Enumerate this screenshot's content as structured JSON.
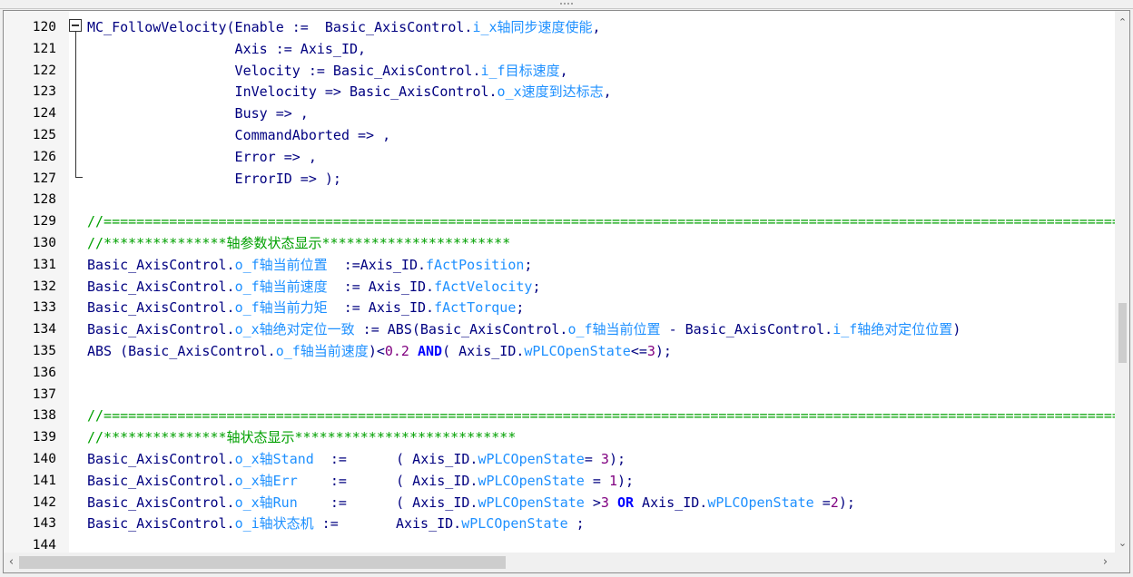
{
  "editor": {
    "lines": [
      {
        "n": "120",
        "code": "MC_FollowVelocity(Enable :=  Basic_AxisControl.i_x轴同步速度使能,"
      },
      {
        "n": "121",
        "code": "                  Axis := Axis_ID,"
      },
      {
        "n": "122",
        "code": "                  Velocity := Basic_AxisControl.i_f目标速度,"
      },
      {
        "n": "123",
        "code": "                  InVelocity => Basic_AxisControl.o_x速度到达标志,"
      },
      {
        "n": "124",
        "code": "                  Busy => ,"
      },
      {
        "n": "125",
        "code": "                  CommandAborted => ,"
      },
      {
        "n": "126",
        "code": "                  Error => ,"
      },
      {
        "n": "127",
        "code": "                  ErrorID => );"
      },
      {
        "n": "128",
        "code": ""
      },
      {
        "n": "129",
        "code": "//=================================================================================================================================="
      },
      {
        "n": "130",
        "code": "//***************轴参数状态显示***********************"
      },
      {
        "n": "131",
        "code": "Basic_AxisControl.o_f轴当前位置  :=Axis_ID.fActPosition;"
      },
      {
        "n": "132",
        "code": "Basic_AxisControl.o_f轴当前速度  := Axis_ID.fActVelocity;"
      },
      {
        "n": "133",
        "code": "Basic_AxisControl.o_f轴当前力矩  := Axis_ID.fActTorque;"
      },
      {
        "n": "134",
        "code": "Basic_AxisControl.o_x轴绝对定位一致 := ABS(Basic_AxisControl.o_f轴当前位置 - Basic_AxisControl.i_f轴绝对定位位置)"
      },
      {
        "n": "135",
        "code": "ABS (Basic_AxisControl.o_f轴当前速度)<0.2 AND( Axis_ID.wPLCOpenState<=3);"
      },
      {
        "n": "136",
        "code": ""
      },
      {
        "n": "137",
        "code": ""
      },
      {
        "n": "138",
        "code": "//=================================================================================================================================="
      },
      {
        "n": "139",
        "code": "//***************轴状态显示***************************"
      },
      {
        "n": "140",
        "code": "Basic_AxisControl.o_x轴Stand  :=      ( Axis_ID.wPLCOpenState= 3);"
      },
      {
        "n": "141",
        "code": "Basic_AxisControl.o_x轴Err    :=      ( Axis_ID.wPLCOpenState = 1);"
      },
      {
        "n": "142",
        "code": "Basic_AxisControl.o_x轴Run    :=      ( Axis_ID.wPLCOpenState >3 OR Axis_ID.wPLCOpenState =2);"
      },
      {
        "n": "143",
        "code": "Basic_AxisControl.o_i轴状态机 :=       Axis_ID.wPLCOpenState ;"
      },
      {
        "n": "144",
        "code": ""
      }
    ]
  },
  "colors": {
    "default": "#000080",
    "member": "#1e90ff",
    "comment": "#00a000",
    "keyword": "#0000ff",
    "number": "#800080"
  },
  "icons": {
    "fold": "fold-minus-icon",
    "scroll_up": "chevron-up-icon",
    "scroll_down": "chevron-down-icon",
    "scroll_left": "chevron-left-icon",
    "scroll_right": "chevron-right-icon"
  }
}
